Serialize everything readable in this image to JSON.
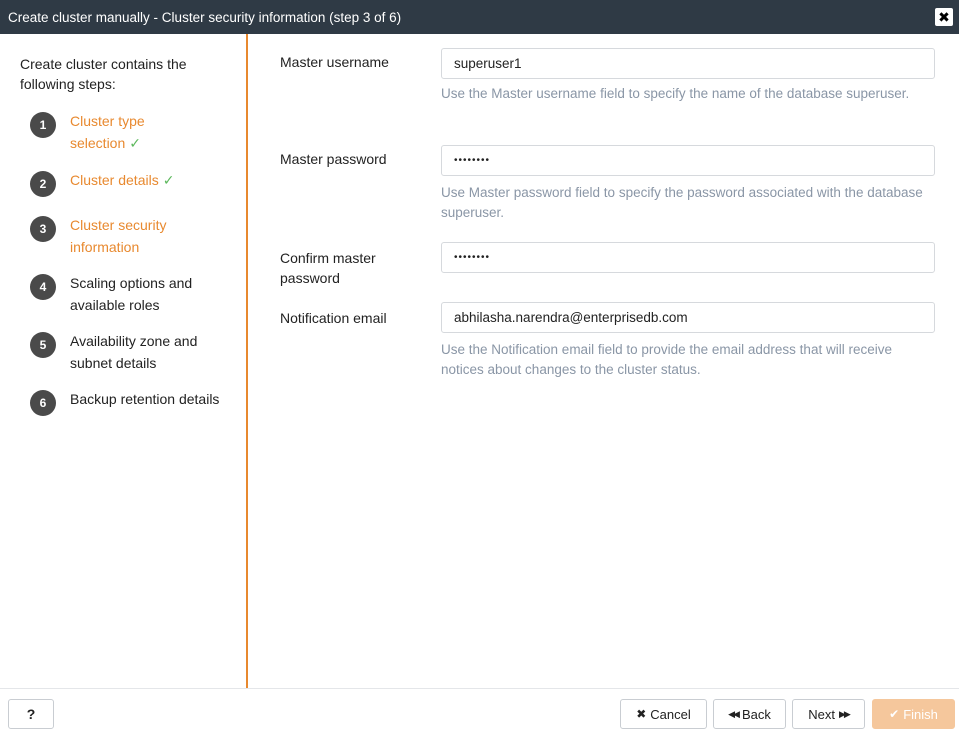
{
  "window": {
    "title": "Create cluster manually - Cluster security information (step 3 of 6)",
    "close_glyph": "✖"
  },
  "sidebar": {
    "intro": "Create cluster contains the following steps:",
    "steps": [
      {
        "num": "1",
        "label": "Cluster type selection",
        "state": "done"
      },
      {
        "num": "2",
        "label": "Cluster details",
        "state": "done"
      },
      {
        "num": "3",
        "label": "Cluster security information",
        "state": "current"
      },
      {
        "num": "4",
        "label": "Scaling options and available roles",
        "state": "pending"
      },
      {
        "num": "5",
        "label": "Availability zone and subnet details",
        "state": "pending"
      },
      {
        "num": "6",
        "label": "Backup retention details",
        "state": "pending"
      }
    ],
    "check_glyph": "✓"
  },
  "form": {
    "master_username": {
      "label": "Master username",
      "value": "superuser1",
      "help": "Use the Master username field to specify the name of the database superuser."
    },
    "master_password": {
      "label": "Master password",
      "value": "••••••••",
      "help": "Use Master password field to specify the password associated with the database superuser."
    },
    "confirm_password": {
      "label": "Confirm master password",
      "value": "••••••••"
    },
    "notification_email": {
      "label": "Notification email",
      "value": "abhilasha.narendra@enterprisedb.com",
      "help": "Use the Notification email field to provide the email address that will receive notices about changes to the cluster status."
    }
  },
  "footer": {
    "help_label": "?",
    "cancel_icon": "✖",
    "cancel_label": "Cancel",
    "back_icon": "◀◀",
    "back_label": "Back",
    "next_label": "Next",
    "next_icon": "▶▶",
    "finish_icon": "✔",
    "finish_label": "Finish"
  },
  "colors": {
    "titlebar": "#2f3a45",
    "accent": "#e8892f",
    "check": "#5cb85c",
    "help_text": "#8a96a6",
    "finish_disabled": "#f5c79c"
  }
}
